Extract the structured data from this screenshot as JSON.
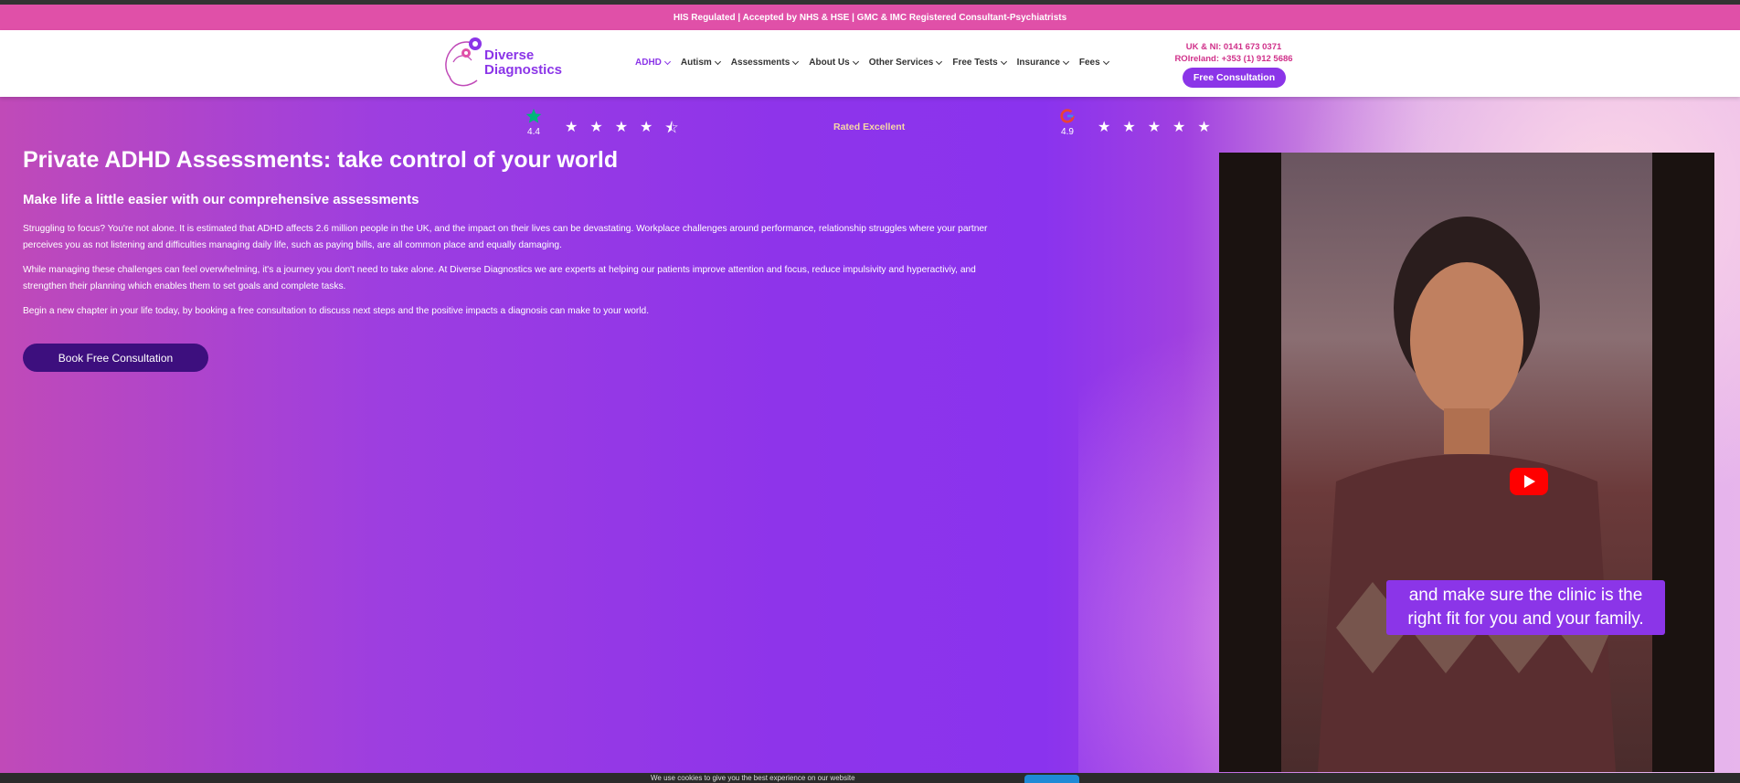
{
  "announcement": "HIS Regulated | Accepted by NHS & HSE  | GMC & IMC Registered Consultant-Psychiatrists",
  "logo": {
    "line1": "Diverse",
    "line2": "Diagnostics"
  },
  "nav": [
    {
      "label": "ADHD",
      "active": true
    },
    {
      "label": "Autism"
    },
    {
      "label": "Assessments"
    },
    {
      "label": "About Us"
    },
    {
      "label": "Other Services"
    },
    {
      "label": "Free Tests"
    },
    {
      "label": "Insurance"
    },
    {
      "label": "Fees"
    }
  ],
  "contact": {
    "uk": "UK & NI: 0141 673 0371",
    "roi": "ROIreland: +353 (1) 912 5686",
    "button": "Free Consultation"
  },
  "ratings": {
    "trustpilot_score": "4.4",
    "rated_text": "Rated Excellent",
    "google_score": "4.9",
    "trustpilot_stars": 4.5,
    "google_stars": 5
  },
  "hero": {
    "title": "Private ADHD Assessments: take control of your world",
    "subtitle": "Make life a little easier with our comprehensive assessments",
    "p1": "Struggling to focus? You're not alone. It is estimated that ADHD affects 2.6 million people in the UK, and the impact on their lives can be devastating. Workplace challenges around performance, relationship struggles where your partner perceives you as not listening and difficulties managing daily life, such as paying bills, are all common place and equally damaging.",
    "p2": "While managing these challenges can feel overwhelming, it's a journey you don't need to take alone. At Diverse Diagnostics we are experts at helping our patients improve attention and focus, reduce impulsivity and hyperactiviy, and strengthen their planning which enables them to set goals and complete tasks.",
    "p3": "Begin a new chapter in your life today, by booking a free consultation to discuss next steps and the positive impacts a diagnosis can make to your world.",
    "cta": "Book Free Consultation"
  },
  "video": {
    "caption": "and make sure the clinic is the right fit for you and your family."
  },
  "cookie": {
    "text": "We use cookies to give you the best experience on our website"
  },
  "colors": {
    "brand_purple": "#8b35e8",
    "brand_pink": "#e050a8",
    "cta_dark": "#3d0f7e"
  }
}
